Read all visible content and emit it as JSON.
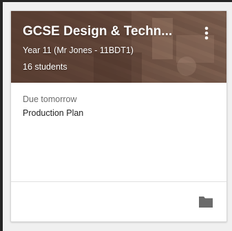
{
  "card": {
    "title": "GCSE Design & Techn...",
    "section": "Year 11 (Mr Jones - 11BDT1)",
    "student_count": "16 students",
    "menu_icon": "more-vert-icon",
    "header_color": "#6a4a3c"
  },
  "upcoming": {
    "due_label": "Due tomorrow",
    "assignment_title": "Production Plan"
  },
  "footer": {
    "folder_icon": "folder-icon",
    "icon_color": "#6b6b6b"
  }
}
